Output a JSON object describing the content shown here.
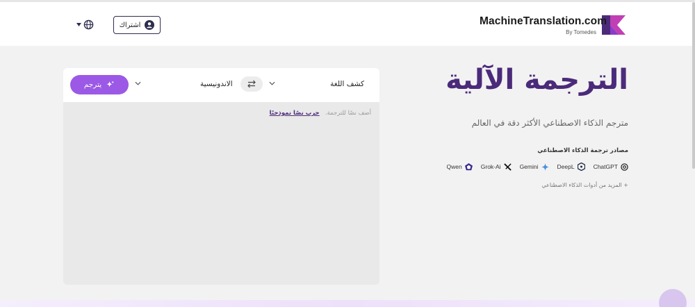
{
  "header": {
    "brand_name": "MachineTranslation.com",
    "brand_sub": "By Tomedes",
    "subscribe_label": "اشتراك",
    "globe_icon": "globe-icon",
    "accent": "#4b2a7a"
  },
  "hero": {
    "title": "الترجمة الآلية",
    "subtitle": "مترجم الذكاء الاصطناعي الأكثر دقة في العالم",
    "ai_sources_title": "مصادر ترجمة الذكاء الاصطناعي",
    "providers": [
      "ChatGPT",
      "DeepL",
      "Gemini",
      "Grok-Ai",
      "Qwen"
    ],
    "more_tools": "+ المزيد من أدوات الذكاء الاصطناعي"
  },
  "translator": {
    "source_lang": "كشف اللغة",
    "target_lang": "الاندونيسية",
    "translate_label": "يترجم",
    "placeholder": "أضف نصًا للترجمة.",
    "sample_link": "جرب نصًا نموذجيًا",
    "button_color": "#9b59e6"
  }
}
